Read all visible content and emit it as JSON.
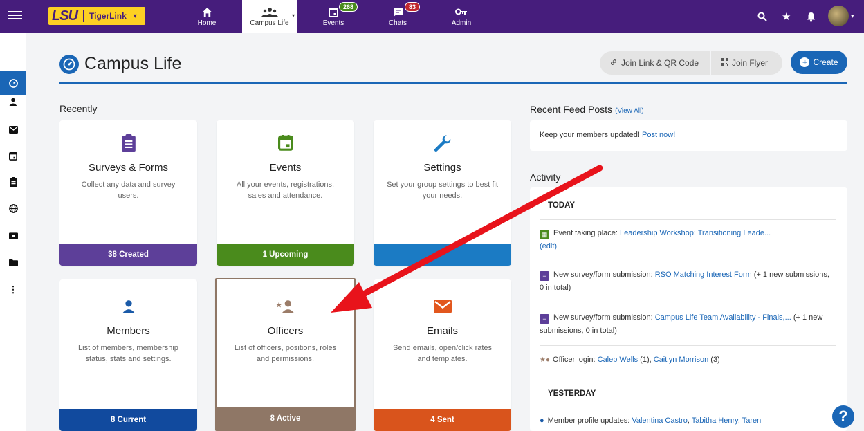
{
  "topnav": {
    "logo": "LSU",
    "app_name": "TigerLink",
    "items": [
      {
        "label": "Home",
        "icon": "home-icon"
      },
      {
        "label": "Campus Life",
        "icon": "group-icon"
      },
      {
        "label": "Events",
        "icon": "calendar-icon",
        "badge": "268"
      },
      {
        "label": "Chats",
        "icon": "chat-icon",
        "badge": "83"
      },
      {
        "label": "Admin",
        "icon": "key-icon"
      }
    ]
  },
  "header": {
    "title": "Campus Life",
    "join_link_label": "Join Link & QR Code",
    "join_flyer_label": "Join Flyer",
    "create_label": "Create"
  },
  "recently": {
    "heading": "Recently",
    "cards": [
      {
        "title": "Surveys & Forms",
        "desc": "Collect any data and survey users.",
        "footer": "38 Created",
        "color": "#5d3f99",
        "icon_color": "#5d3f99"
      },
      {
        "title": "Events",
        "desc": "All your events, registrations, sales and attendance.",
        "footer": "1 Upcoming",
        "color": "#4a8b1c",
        "icon_color": "#4a8b1c"
      },
      {
        "title": "Settings",
        "desc": "Set your group settings to best fit your needs.",
        "footer": "",
        "color": "#1b7bc4",
        "icon_color": "#1b7bc4"
      },
      {
        "title": "Members",
        "desc": "List of members, membership status, stats and settings.",
        "footer": "8 Current",
        "color": "#114a9e",
        "icon_color": "#1a5aa8"
      },
      {
        "title": "Officers",
        "desc": "List of officers, positions, roles and permissions.",
        "footer": "8 Active",
        "color": "#8f7766",
        "icon_color": "#9b7c68"
      },
      {
        "title": "Emails",
        "desc": "Send emails, open/click rates and templates.",
        "footer": "4 Sent",
        "color": "#d9541c",
        "icon_color": "#e2571e"
      }
    ]
  },
  "feed": {
    "heading": "Recent Feed Posts",
    "view_all": "(View All)",
    "message": "Keep your members updated!",
    "post_link": "Post now!"
  },
  "activity": {
    "heading": "Activity",
    "today": "TODAY",
    "yesterday": "YESTERDAY",
    "rows": [
      {
        "prefix": "Event taking place: ",
        "link": "Leadership Workshop: Transitioning Leade...",
        "suffix": "",
        "link2": "(edit)"
      },
      {
        "prefix": "New survey/form submission: ",
        "link": "RSO Matching Interest Form",
        "suffix": " (+ 1 new submissions, 0 in total)"
      },
      {
        "prefix": "New survey/form submission: ",
        "link": "Campus Life Team Availability - Finals,...",
        "suffix": " (+ 1 new submissions, 0 in total)"
      },
      {
        "prefix": "Officer login: ",
        "link": "Caleb Wells",
        "mid": " (1), ",
        "link2": "Caitlyn Morrison",
        "suffix": " (3)"
      },
      {
        "prefix": "Member profile updates: ",
        "link": "Valentina Castro",
        "mid": ", ",
        "link2": "Tabitha Henry",
        "mid2": ", ",
        "link3": "Taren"
      }
    ]
  },
  "colors": {
    "brand_purple": "#461d7c",
    "brand_gold": "#fdd023",
    "accent_blue": "#1a66b6",
    "annotation_red": "#e8131b"
  }
}
